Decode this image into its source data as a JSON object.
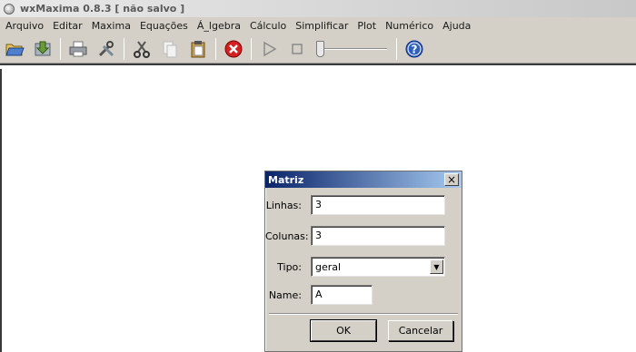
{
  "window": {
    "title": "wxMaxima 0.8.3 [ não salvo ]"
  },
  "menu": [
    "Arquivo",
    "Editar",
    "Maxima",
    "Equações",
    "Á_lgebra",
    "Cálculo",
    "Simplificar",
    "Plot",
    "Numérico",
    "Ajuda"
  ],
  "toolbar": {
    "icons": [
      "open-folder-icon",
      "save-icon",
      "print-icon",
      "preferences-icon",
      "cut-icon",
      "copy-icon",
      "paste-icon",
      "interrupt-icon",
      "play-icon",
      "stop-icon",
      "animation-slider",
      "help-icon"
    ]
  },
  "dialog": {
    "title": "Matriz",
    "rows_label": "Linhas:",
    "rows_value": "3",
    "cols_label": "Colunas:",
    "cols_value": "3",
    "type_label": "Tipo:",
    "type_value": "geral",
    "name_label": "Name:",
    "name_value": "A",
    "ok_label": "OK",
    "cancel_label": "Cancelar"
  },
  "colors": {
    "titlebar_active": "#0a246a",
    "chrome": "#d4d0c8"
  }
}
